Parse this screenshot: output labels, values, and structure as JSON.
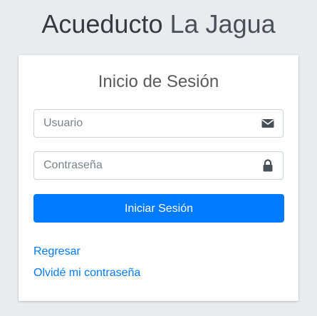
{
  "header": {
    "title_strong": "Acueducto",
    "title_light": "La Jagua"
  },
  "login": {
    "title": "Inicio de Sesión",
    "username": {
      "placeholder": "Usuario",
      "value": "",
      "icon": "envelope-icon"
    },
    "password": {
      "placeholder": "Contraseña",
      "value": "",
      "icon": "lock-icon"
    },
    "submit_label": "Iniciar Sesión",
    "back_link": "Regresar",
    "forgot_link": "Olvidé mi contraseña"
  },
  "colors": {
    "primary": "#007bff",
    "background": "#e9ecef",
    "card": "#ffffff",
    "icon": "#495057"
  }
}
